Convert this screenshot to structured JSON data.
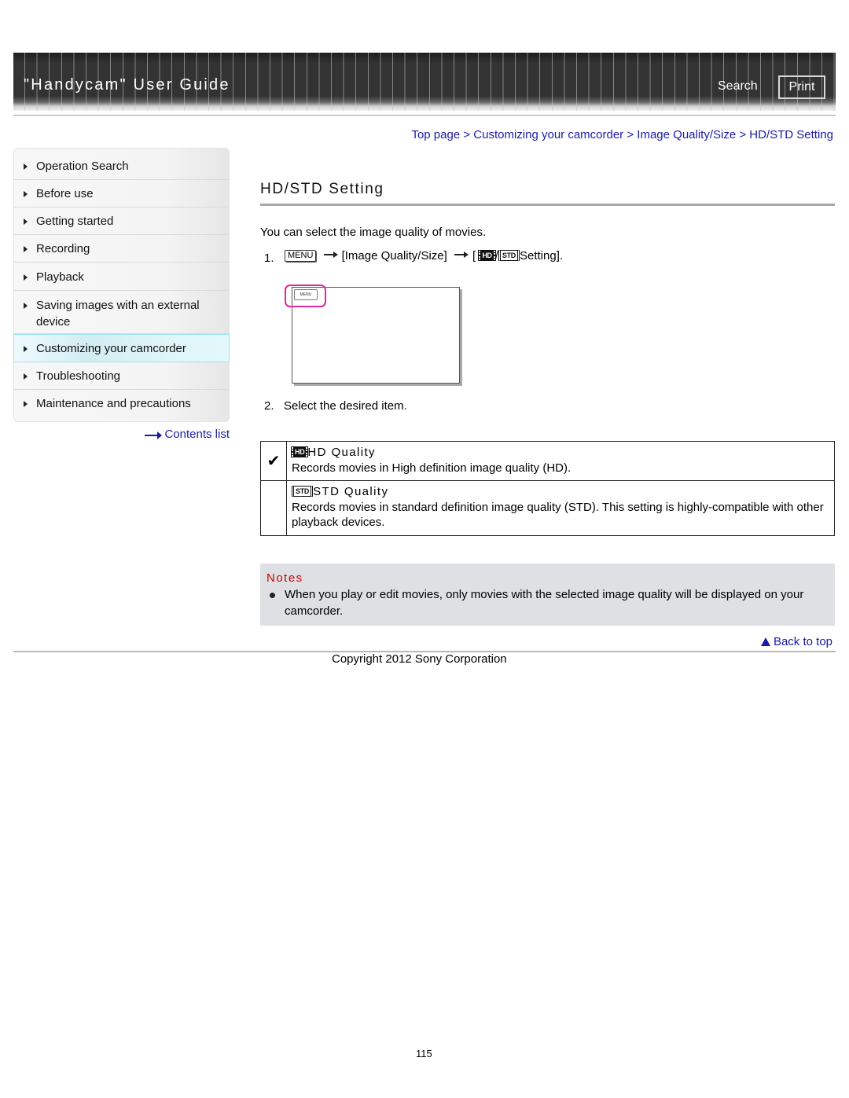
{
  "header": {
    "title": "\"Handycam\" User Guide",
    "search_label": "Search",
    "print_label": "Print"
  },
  "breadcrumb": {
    "items": [
      "Top page",
      "Customizing your camcorder",
      "Image Quality/Size",
      "HD/STD Setting"
    ],
    "separator": ">"
  },
  "sidebar": {
    "items": [
      {
        "label": "Operation Search",
        "active": false
      },
      {
        "label": "Before use",
        "active": false
      },
      {
        "label": "Getting started",
        "active": false
      },
      {
        "label": "Recording",
        "active": false
      },
      {
        "label": "Playback",
        "active": false
      },
      {
        "label": "Saving images with an external device",
        "active": false
      },
      {
        "label": "Customizing your camcorder",
        "active": true
      },
      {
        "label": "Troubleshooting",
        "active": false
      },
      {
        "label": "Maintenance and precautions",
        "active": false
      }
    ],
    "contents_link": "Contents list"
  },
  "main": {
    "title": "HD/STD Setting",
    "intro": "You can select the image quality of movies.",
    "step1": {
      "number": "1.",
      "menu_key": "MENU",
      "path_item": "[Image Quality/Size]",
      "open_bracket": "[",
      "hd_badge": "HD",
      "slash": "/",
      "std_badge": "STD",
      "setting_text": "Setting]."
    },
    "illustration": {
      "menu_key": "MENU"
    },
    "step2": {
      "number": "2.",
      "text": "Select the desired item."
    },
    "options": [
      {
        "selected": true,
        "check_icon": "✔",
        "badge": "HD",
        "name": "HD Quality",
        "description": "Records movies in High definition image quality (HD)."
      },
      {
        "selected": false,
        "check_icon": "",
        "badge": "STD",
        "name": "STD Quality",
        "description": "Records movies in standard definition image quality (STD). This setting is highly-compatible with other playback devices."
      }
    ],
    "notes": {
      "title": "Notes",
      "items": [
        "When you play or edit movies, only movies with the selected image quality will be displayed on your camcorder."
      ]
    }
  },
  "footer": {
    "back_to_top": "Back to top",
    "copyright": "Copyright 2012 Sony Corporation",
    "page_number": "115"
  },
  "colors": {
    "link": "#1a1aa6",
    "notes_title": "#cc0000",
    "highlight": "#e0289a",
    "active_nav": "#d2edf2"
  }
}
